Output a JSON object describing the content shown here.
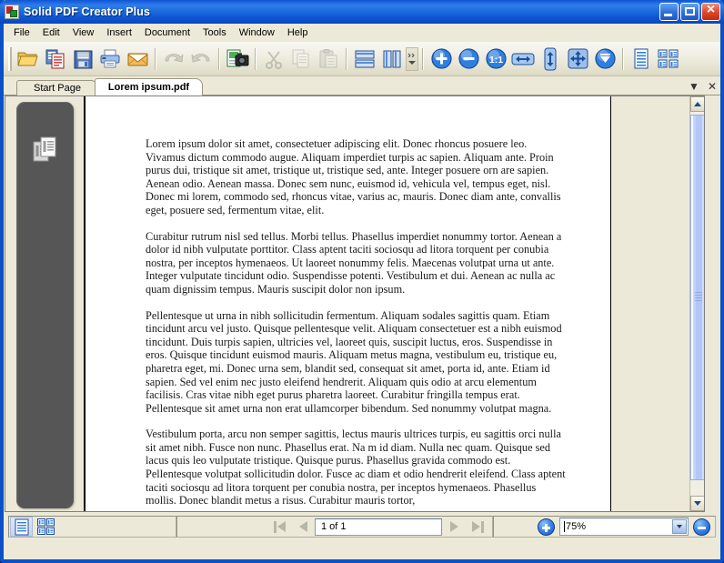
{
  "window": {
    "title": "Solid PDF Creator Plus",
    "app_icon": "app-icon",
    "buttons": {
      "minimize": "Minimize",
      "maximize": "Maximize",
      "close": "Close"
    }
  },
  "menubar": {
    "items": [
      {
        "label": "File"
      },
      {
        "label": "Edit"
      },
      {
        "label": "View"
      },
      {
        "label": "Insert"
      },
      {
        "label": "Document"
      },
      {
        "label": "Tools"
      },
      {
        "label": "Window"
      },
      {
        "label": "Help"
      }
    ]
  },
  "toolbar": {
    "groups": [
      {
        "buttons": [
          {
            "name": "open-folder-icon",
            "title": "Open",
            "enabled": true
          },
          {
            "name": "new-document-icon",
            "title": "New PDF",
            "enabled": true
          },
          {
            "name": "save-floppy-icon",
            "title": "Save",
            "enabled": true
          },
          {
            "name": "print-icon",
            "title": "Print",
            "enabled": true
          },
          {
            "name": "email-icon",
            "title": "Email",
            "enabled": true
          }
        ]
      },
      {
        "buttons": [
          {
            "name": "undo-arrow-icon",
            "title": "Undo",
            "enabled": false
          },
          {
            "name": "redo-arrow-icon",
            "title": "Redo",
            "enabled": false
          }
        ]
      },
      {
        "buttons": [
          {
            "name": "scan-camera-icon",
            "title": "Scan",
            "enabled": true
          }
        ]
      },
      {
        "buttons": [
          {
            "name": "cut-scissors-icon",
            "title": "Cut",
            "enabled": false
          },
          {
            "name": "copy-pages-icon",
            "title": "Copy",
            "enabled": false
          },
          {
            "name": "paste-clipboard-icon",
            "title": "Paste",
            "enabled": false
          }
        ]
      },
      {
        "buttons": [
          {
            "name": "layout-rows-icon",
            "title": "Horizontal layout",
            "enabled": true
          },
          {
            "name": "layout-columns-icon",
            "title": "Vertical layout",
            "enabled": true
          }
        ]
      },
      {
        "buttons": [
          {
            "name": "zoom-in-icon",
            "title": "Zoom in",
            "enabled": true
          },
          {
            "name": "zoom-out-icon",
            "title": "Zoom out",
            "enabled": true
          },
          {
            "name": "actual-size-icon",
            "title": "Actual size 1:1",
            "enabled": true
          },
          {
            "name": "fit-width-icon",
            "title": "Fit width",
            "enabled": true
          },
          {
            "name": "fit-height-icon",
            "title": "Fit height",
            "enabled": true
          },
          {
            "name": "pan-move-icon",
            "title": "Pan",
            "enabled": true
          },
          {
            "name": "scroll-page-icon",
            "title": "Continuous scroll",
            "enabled": true
          }
        ]
      },
      {
        "buttons": [
          {
            "name": "single-page-view-icon",
            "title": "Single page view",
            "enabled": true
          },
          {
            "name": "thumbnails-view-icon",
            "title": "Thumbnail view",
            "enabled": true
          }
        ]
      }
    ],
    "overflow_label": "More toolbar buttons"
  },
  "tabs": {
    "items": [
      {
        "label": "Start Page",
        "active": false
      },
      {
        "label": "Lorem ipsum.pdf",
        "active": true
      }
    ],
    "list_arrow": "▼",
    "close": "✕"
  },
  "sidebar": {
    "thumbnail_panel_icon": "pages-icon"
  },
  "document": {
    "paragraphs": [
      "Lorem ipsum dolor sit amet, consectetuer adipiscing elit. Donec rhoncus posuere leo. Vivamus dictum commodo augue. Aliquam imperdiet turpis ac sapien. Aliquam ante. Proin purus dui, tristique sit amet, tristique ut, tristique sed, ante. Integer posuere orn are sapien. Aenean odio. Aenean massa. Donec sem nunc, euismod id, vehicula vel, tempus eget, nisl. Donec mi lorem, commodo sed, rhoncus vitae, varius ac, mauris. Donec diam ante, convallis eget, posuere sed, fermentum vitae, elit.",
      "Curabitur rutrum nisl sed tellus. Morbi tellus. Phasellus imperdiet nonummy tortor. Aenean a dolor id nibh vulputate porttitor. Class aptent taciti sociosqu ad litora torquent per conubia nostra, per inceptos hymenaeos. Ut laoreet nonummy felis. Maecenas volutpat urna ut ante. Integer vulputate tincidunt odio. Suspendisse potenti. Vestibulum et dui. Aenean ac nulla ac quam dignissim tempus. Mauris suscipit dolor non ipsum.",
      "Pellentesque ut urna in nibh sollicitudin fermentum. Aliquam sodales sagittis quam. Etiam tincidunt arcu vel justo. Quisque pellentesque velit. Aliquam consectetuer est a nibh euismod tincidunt. Duis turpis sapien, ultricies vel, laoreet quis, suscipit luctus, eros. Suspendisse in eros. Quisque tincidunt euismod mauris. Aliquam metus magna, vestibulum eu, tristique eu, pharetra eget, mi. Donec urna sem, blandit sed, consequat sit amet, porta id, ante. Etiam id sapien. Sed vel enim nec justo eleifend hendrerit. Aliquam quis odio at arcu elementum facilisis. Cras vitae nibh eget purus pharetra laoreet. Curabitur fringilla tempus erat. Pellentesque sit amet urna non erat ullamcorper bibendum. Sed nonummy volutpat magna.",
      "Vestibulum porta, arcu non semper sagittis, lectus mauris ultrices turpis, eu sagittis orci nulla sit amet nibh. Fusce non nunc. Phasellus erat. Na m id diam. Nulla nec quam. Quisque sed lacus quis leo vulputate tristique. Quisque purus. Phasellus gravida commodo est. Pellentesque volutpat sollicitudin dolor. Fusce ac diam et odio hendrerit eleifend. Class aptent taciti sociosqu ad litora torquent per  conubia nostra, per inceptos hymenaeos. Phasellus mollis. Donec blandit metus a risus. Curabitur mauris tortor,"
    ]
  },
  "statusbar": {
    "view_buttons": [
      {
        "name": "page-view-button",
        "title": "Page view",
        "pressed": true
      },
      {
        "name": "grid-view-button",
        "title": "Grid view",
        "pressed": false
      }
    ],
    "navigation": {
      "first": "First page",
      "previous": "Previous page",
      "next": "Next page",
      "last": "Last page",
      "page_value": "1 of 1"
    },
    "zoom": {
      "in_button": "Zoom in",
      "out_button": "Zoom out",
      "value": "75%",
      "dropdown": "Zoom presets"
    }
  },
  "colors": {
    "titlebar_blue": "#2f7ce8",
    "frame_blue": "#0a50c8",
    "chrome": "#ece9d8",
    "accent": "#3f88e6",
    "page_white": "#ffffff"
  }
}
